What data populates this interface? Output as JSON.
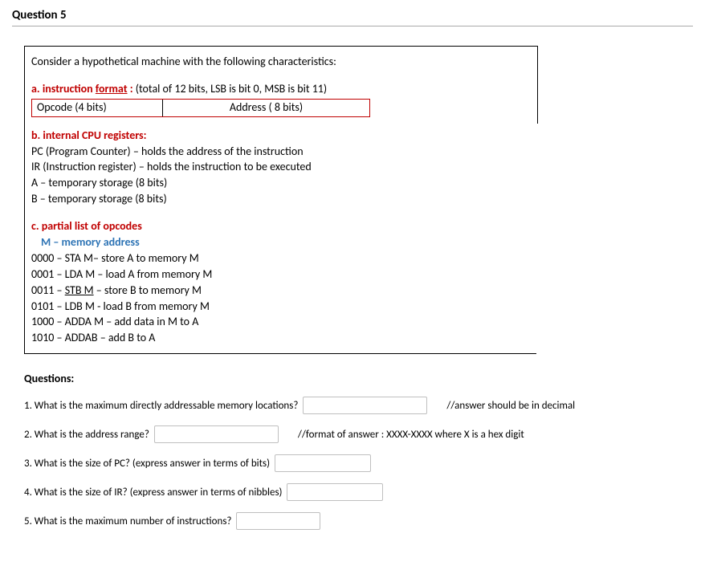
{
  "questionNumber": "Question 5",
  "box": {
    "intro": "Consider a hypothetical machine with the following characteristics:",
    "a": {
      "label": "a. instruction ",
      "formatWord": "format",
      "colon": " : ",
      "desc": "(total of 12 bits, LSB is bit 0, MSB is bit 11)",
      "opcode": "Opcode (4 bits)",
      "address": "Address ( 8 bits)"
    },
    "b": {
      "label": "b. internal CPU registers:",
      "lines": [
        "PC (Program Counter) – holds the address of the instruction",
        "IR (Instruction register) – holds the instruction to be executed",
        "A – temporary storage (8 bits)",
        "B – temporary storage (8 bits)"
      ]
    },
    "c": {
      "label": "c. partial list of opcodes",
      "mline": "M – memory address",
      "ops": [
        {
          "code": "0000 – STA M– store A to memory M",
          "und": false
        },
        {
          "code": "0001 – LDA M – load A from memory M",
          "und": false
        },
        {
          "code_pre": "0011 – ",
          "mid": "STB  M",
          "code_post": " – store B to memory M",
          "und": true
        },
        {
          "code": "0101 – LDB M - load B from memory M",
          "und": false
        },
        {
          "code": "1000 – ADDA M – add data in M to A",
          "und": false
        },
        {
          "code": "1010 – ADDAB – add B to A",
          "und": false
        }
      ]
    }
  },
  "questions": {
    "title": "Questions:",
    "q1": "1. What is the maximum directly addressable memory locations?",
    "q1hint": "//answer should be in decimal",
    "q2": "2. What is the address range?",
    "q2hint": "//format of answer :   XXXX-XXXX    where X is a hex digit",
    "q3": "3. What is the size of  PC? (express answer in terms of bits)",
    "q4": "4. What is the size of IR? (express answer in terms of nibbles)",
    "q5": "5. What is the maximum number of instructions?"
  }
}
